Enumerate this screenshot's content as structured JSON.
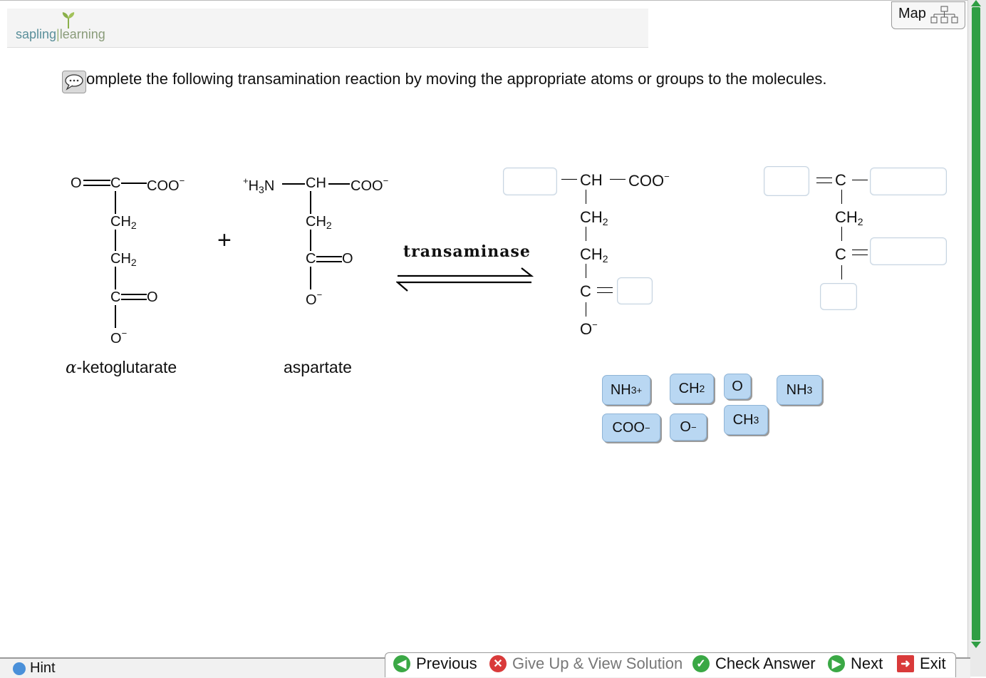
{
  "header": {
    "logo_part1": "sapling",
    "logo_part2": "learning",
    "map_label": "Map"
  },
  "question": {
    "text": "omplete the following transamination reaction by moving the appropriate atoms or groups to the molecules."
  },
  "reactants": {
    "ketoglutarate": {
      "top_o": "O",
      "top_c": "C",
      "coo": "COO",
      "charge": "−",
      "ch2_a": "CH",
      "ch2_b": "CH",
      "sub2": "2",
      "c_carbonyl": "C",
      "o_carbonyl": "O",
      "o_minus": "O",
      "name_alpha": "α",
      "name_rest": "-ketoglutarate"
    },
    "plus_sign": "+",
    "aspartate": {
      "plus": "+",
      "h3n": "H",
      "h3n_sub": "3",
      "h3n_n": "N",
      "ch": "CH",
      "coo": "COO",
      "charge": "−",
      "ch2": "CH",
      "sub2": "2",
      "c_carbonyl": "C",
      "o_carbonyl": "O",
      "o_minus": "O",
      "name": "aspartate"
    }
  },
  "enzyme": "transaminase",
  "products": {
    "p1": {
      "ch": "CH",
      "coo": "COO",
      "charge": "−",
      "ch2_a": "CH",
      "ch2_b": "CH",
      "sub2": "2",
      "c": "C",
      "o_minus": "O"
    },
    "p2": {
      "c_top": "C",
      "ch2": "CH",
      "sub2": "2",
      "c_mid": "C"
    }
  },
  "tiles": [
    {
      "main": "NH",
      "sub": "3",
      "sup": "+"
    },
    {
      "main": "CH",
      "sub": "2",
      "sup": ""
    },
    {
      "main": "O",
      "sub": "",
      "sup": ""
    },
    {
      "main": "NH",
      "sub": "3",
      "sup": ""
    },
    {
      "main": "COO",
      "sub": "",
      "sup": "−"
    },
    {
      "main": "O",
      "sub": "",
      "sup": "−"
    },
    {
      "main": "CH",
      "sub": "3",
      "sup": ""
    }
  ],
  "footer": {
    "hint": "Hint",
    "previous": "Previous",
    "giveup": "Give Up & View Solution",
    "check": "Check Answer",
    "next": "Next",
    "exit": "Exit"
  },
  "colors": {
    "tile_fill": "#b9d7f2",
    "scroll_green": "#2f9e44",
    "logo_blue": "#5a8f9a"
  }
}
